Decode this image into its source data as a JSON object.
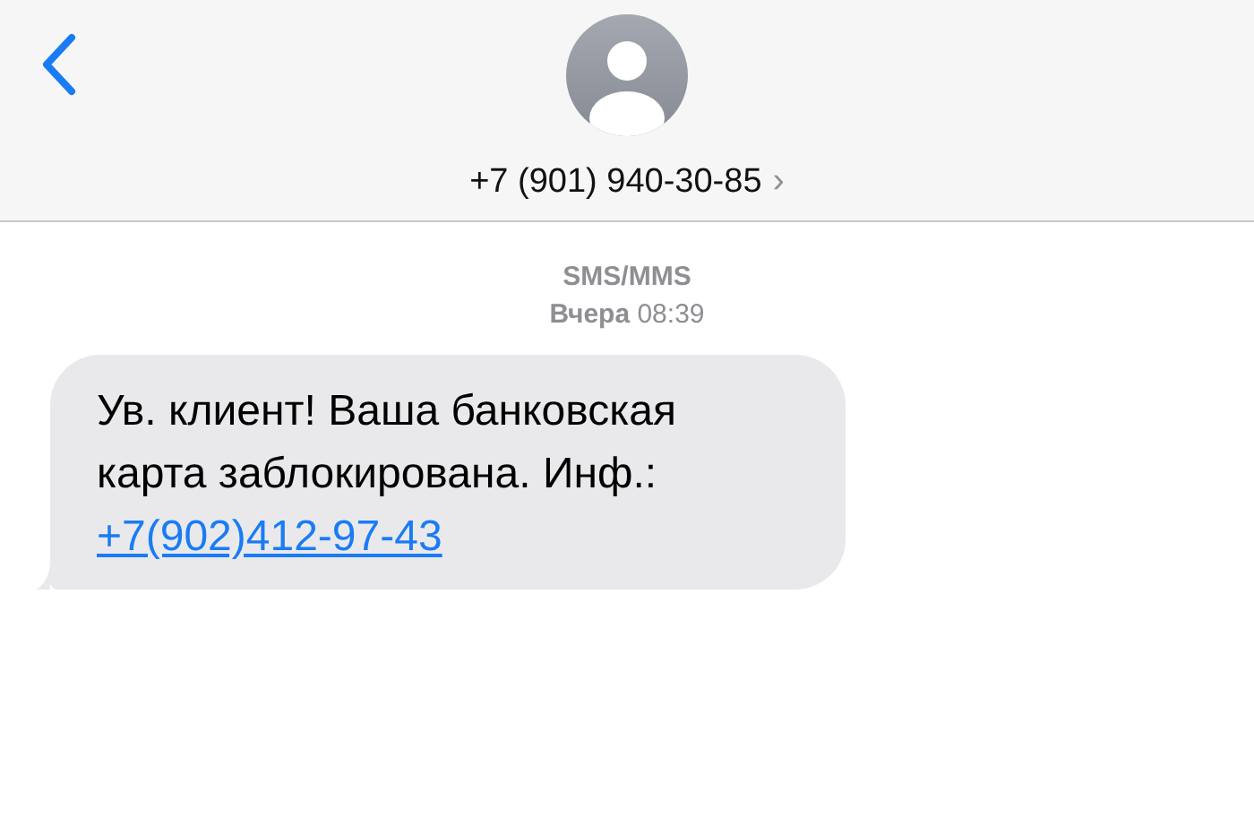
{
  "header": {
    "contact": "+7 (901) 940-30-85",
    "chevron": "›"
  },
  "thread": {
    "service": "SMS/MMS",
    "timestamp": "**Вчера** 08:39"
  },
  "messages": [
    {
      "kind": "incoming",
      "text": "Ув. клиент! Ваша банковская карта заблокирована. Инф.:",
      "link": "+7(902)412-97-43"
    }
  ]
}
